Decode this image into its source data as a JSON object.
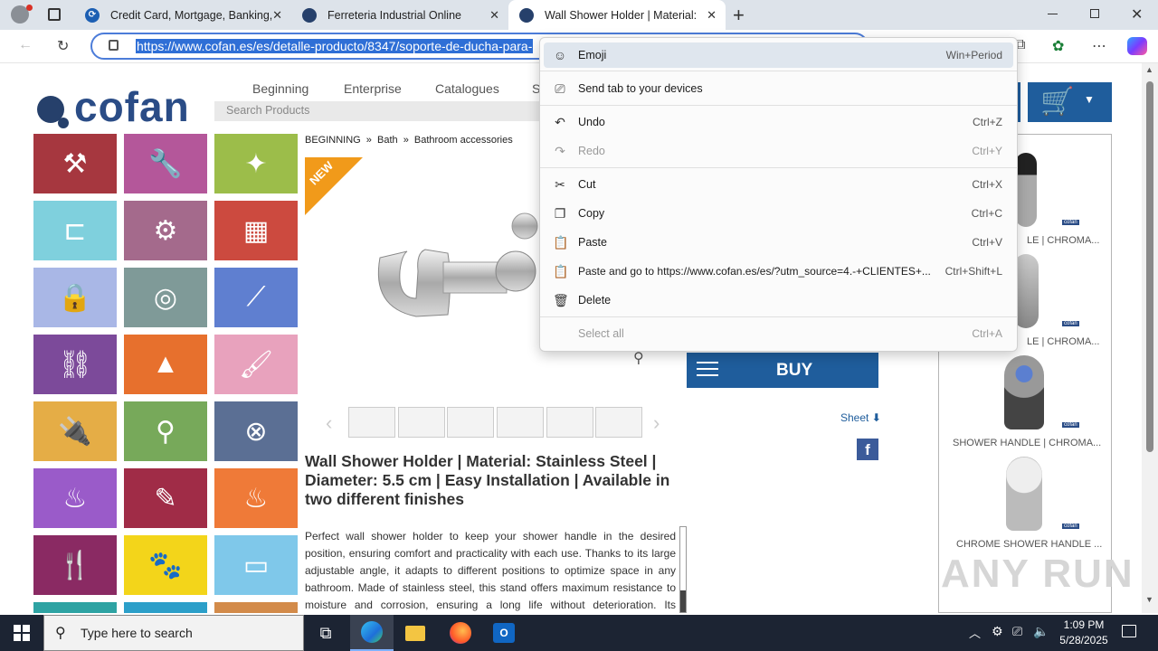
{
  "tabs": [
    {
      "title": "Credit Card, Mortgage, Banking,",
      "color": "#1c5fb3"
    },
    {
      "title": "Ferreteria Industrial Online",
      "color": "#26406b"
    },
    {
      "title": "Wall Shower Holder | Material: St",
      "color": "#26406b"
    }
  ],
  "url": "https://www.cofan.es/es/detalle-producto/8347/soporte-de-ducha-para-",
  "site": {
    "logo": "cofan",
    "nav": [
      "Beginning",
      "Enterprise",
      "Catalogues",
      "S"
    ],
    "search_placeholder": "Search Products",
    "breadcrumb": [
      "BEGINNING",
      "»",
      "Bath",
      "»",
      "Bathroom accessories"
    ],
    "badge": "NEW",
    "title": "Wall Shower Holder | Material: Stainless Steel | Diameter: 5.5 cm | Easy Installation | Available in two different finishes",
    "description": "Perfect wall shower holder to keep your shower handle in the desired position, ensuring comfort and practicality with each use. Thanks to its large adjustable angle, it adapts to different positions to optimize space in any bathroom. Made of stainless steel, this stand offers maximum resistance to moisture and corrosion, ensuring a long life without deterioration. Its installation is quick and",
    "buy_label": "BUY",
    "sheet_label": "Sheet",
    "facebook": "f",
    "side_labels": [
      "LE | CHROMA...",
      "LE | CHROMA...",
      "SHOWER HANDLE | CHROMA...",
      "CHROME SHOWER HANDLE ..."
    ],
    "side_brand": "cofan"
  },
  "menu": [
    {
      "label": "Emoji",
      "shortcut": "Win+Period",
      "icon": "☺",
      "disabled": false,
      "highlight": true
    },
    {
      "label": "Send tab to your devices",
      "shortcut": "",
      "icon": "⎚",
      "disabled": false
    },
    {
      "label": "Undo",
      "shortcut": "Ctrl+Z",
      "icon": "↶",
      "disabled": false
    },
    {
      "label": "Redo",
      "shortcut": "Ctrl+Y",
      "icon": "↷",
      "disabled": true
    },
    {
      "label": "Cut",
      "shortcut": "Ctrl+X",
      "icon": "✂",
      "disabled": false
    },
    {
      "label": "Copy",
      "shortcut": "Ctrl+C",
      "icon": "❐",
      "disabled": false
    },
    {
      "label": "Paste",
      "shortcut": "Ctrl+V",
      "icon": "📋",
      "disabled": false
    },
    {
      "label": "Paste and go to https://www.cofan.es/es/?utm_source=4.-+CLIENTES+...",
      "shortcut": "Ctrl+Shift+L",
      "icon": "📋",
      "disabled": false
    },
    {
      "label": "Delete",
      "shortcut": "",
      "icon": "🗑",
      "disabled": false
    },
    {
      "label": "Select all",
      "shortcut": "Ctrl+A",
      "icon": "",
      "disabled": true
    }
  ],
  "taskbar": {
    "search_placeholder": "Type here to search",
    "time": "1:09 PM",
    "date": "5/28/2025"
  },
  "watermark": "ANY RUN"
}
